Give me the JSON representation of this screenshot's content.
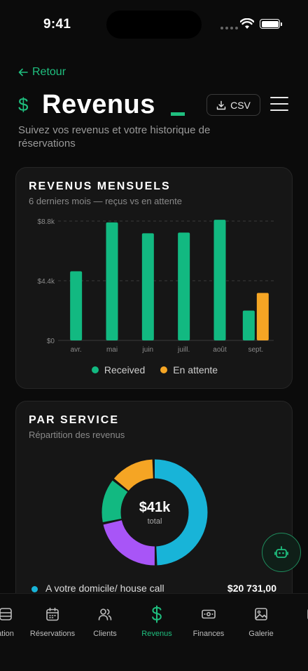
{
  "status_bar": {
    "time": "9:41"
  },
  "header": {
    "back_label": "Retour",
    "title_symbol": "$",
    "title": "Revenus",
    "csv_label": "CSV",
    "subtitle": "Suivez vos revenus et votre historique de réservations"
  },
  "monthly_card": {
    "title": "Revenus mensuels",
    "subtitle": "6 derniers mois — reçus vs en attente"
  },
  "chart_data": {
    "type": "bar",
    "categories": [
      "avr.",
      "mai",
      "juin",
      "juill.",
      "août",
      "sept."
    ],
    "series": [
      {
        "name": "Received",
        "values": [
          5100,
          8700,
          7900,
          7950,
          8900,
          2200
        ],
        "color": "#12b981"
      },
      {
        "name": "En attente",
        "values": [
          0,
          0,
          0,
          0,
          0,
          3500
        ],
        "color": "#f5a524"
      }
    ],
    "ylim": [
      0,
      8800
    ],
    "yticks": [
      0,
      4400,
      8800
    ],
    "ytick_labels": [
      "$0",
      "$4.4k",
      "$8.8k"
    ],
    "grid": true,
    "legend": "bottom"
  },
  "service_card": {
    "title": "Par service",
    "subtitle": "Répartition des revenus",
    "total_value": "$41k",
    "total_label": "total",
    "slices": [
      {
        "name": "A votre domicile/ house call",
        "fraction": 0.5,
        "color": "#18b4d8"
      },
      {
        "fraction": 0.22,
        "color": "#a855f7"
      },
      {
        "fraction": 0.14,
        "color": "#12b981"
      },
      {
        "fraction": 0.14,
        "color": "#f5a524"
      }
    ],
    "rows": [
      {
        "name": "A votre domicile/ house call",
        "amount": "$20 731,00",
        "color": "#18b4d8"
      }
    ]
  },
  "tabbar": {
    "items": [
      {
        "label": "ation",
        "icon": "grid-icon"
      },
      {
        "label": "Réservations",
        "icon": "calendar-icon"
      },
      {
        "label": "Clients",
        "icon": "users-icon"
      },
      {
        "label": "Revenus",
        "icon": "dollar-icon"
      },
      {
        "label": "Finances",
        "icon": "banknote-icon"
      },
      {
        "label": "Galerie",
        "icon": "image-icon"
      },
      {
        "label": "Fa",
        "icon": "more-icon"
      }
    ],
    "active_color": "#1fbf7f"
  }
}
